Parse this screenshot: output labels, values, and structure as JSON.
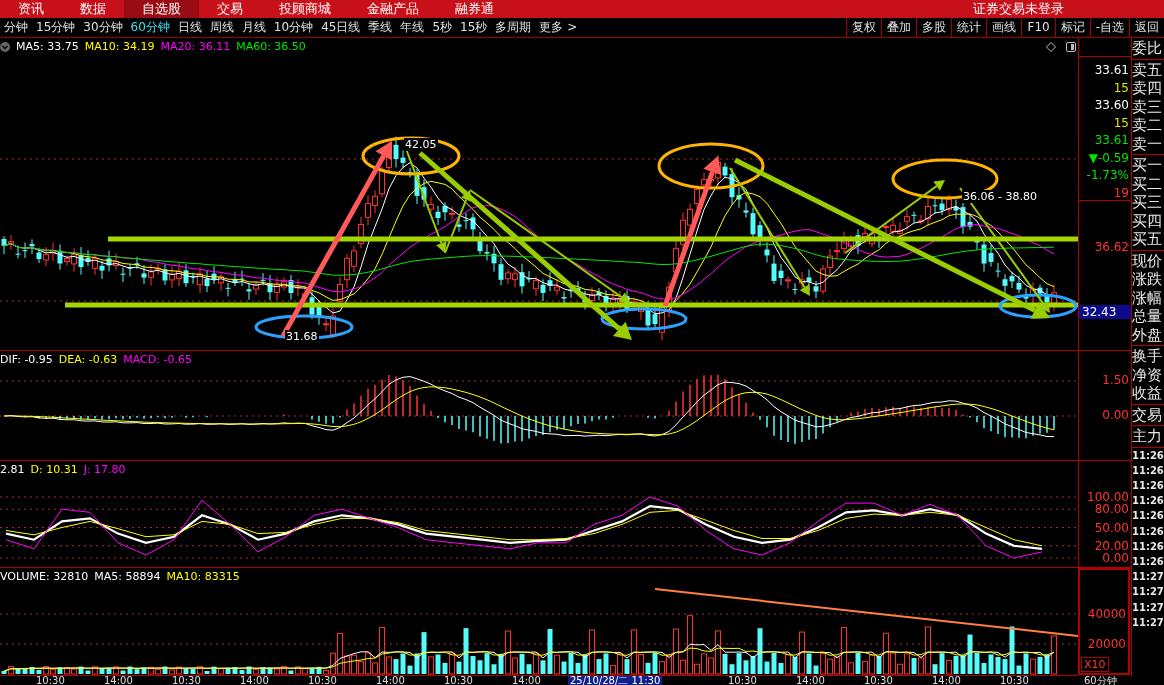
{
  "top_menu": [
    {
      "label": "资讯",
      "selected": false
    },
    {
      "label": "数据",
      "selected": false
    },
    {
      "label": "自选股",
      "selected": true
    },
    {
      "label": "交易",
      "selected": false
    },
    {
      "label": "投顾商城",
      "selected": false
    },
    {
      "label": "金融产品",
      "selected": false
    },
    {
      "label": "融券通",
      "selected": false
    }
  ],
  "top_status": "证券交易未登录",
  "periods": [
    {
      "label": "分钟",
      "selected": false
    },
    {
      "label": "15分钟",
      "selected": false
    },
    {
      "label": "30分钟",
      "selected": false
    },
    {
      "label": "60分钟",
      "selected": true
    },
    {
      "label": "日线",
      "selected": false
    },
    {
      "label": "周线",
      "selected": false
    },
    {
      "label": "月线",
      "selected": false
    },
    {
      "label": "10分钟",
      "selected": false
    },
    {
      "label": "45日线",
      "selected": false
    },
    {
      "label": "季线",
      "selected": false
    },
    {
      "label": "年线",
      "selected": false
    },
    {
      "label": "5秒",
      "selected": false
    },
    {
      "label": "15秒",
      "selected": false
    },
    {
      "label": "多周期",
      "selected": false
    }
  ],
  "more": "更多 >",
  "tools": [
    "复权",
    "叠加",
    "多股",
    "统计",
    "画线",
    "F10",
    "标记",
    "-自选",
    "返回"
  ],
  "main_chart": {
    "legend": [
      {
        "label": "MA5: 33.75",
        "color": "#ffffff"
      },
      {
        "label": "MA10: 34.19",
        "color": "#ffff00"
      },
      {
        "label": "MA20: 36.11",
        "color": "#ff00ff"
      },
      {
        "label": "MA60: 36.50",
        "color": "#00e600"
      }
    ],
    "high_label": "42.05",
    "low_label": "31.68",
    "range_label": "36.06 - 38.80"
  },
  "quote": [
    {
      "text": "33.61",
      "color": "#ffffff"
    },
    {
      "text": "15",
      "color": "#e6e600"
    },
    {
      "text": "33.60",
      "color": "#ffffff"
    },
    {
      "text": "15",
      "color": "#e6e600"
    },
    {
      "text": "33.61",
      "color": "#00e600"
    },
    {
      "text": "▼-0.59",
      "color": "#00e600"
    },
    {
      "text": "-1.73%",
      "color": "#00e600"
    },
    {
      "text": "19",
      "color": "#ff3232"
    }
  ],
  "price_marks": [
    {
      "text": "36.62",
      "kind": "line"
    },
    {
      "text": "32.43",
      "kind": "cursor"
    }
  ],
  "macd": {
    "legend": [
      {
        "label": "DIF: -0.95",
        "color": "#ffffff"
      },
      {
        "label": "DEA: -0.63",
        "color": "#ffff00"
      },
      {
        "label": "MACD: -0.65",
        "color": "#ff00ff"
      }
    ],
    "axis": [
      "1.50",
      "0.00"
    ]
  },
  "kdj": {
    "legend": [
      {
        "label": "2.81",
        "color": "#ffffff"
      },
      {
        "label": "D: 10.31",
        "color": "#ffff00"
      },
      {
        "label": "J: 17.80",
        "color": "#ff00ff"
      }
    ],
    "chart_data": {
      "type": "line",
      "ylim": [
        0,
        100
      ],
      "grid": true,
      "yticks": [
        {
          "value": 100,
          "label": "100.00"
        },
        {
          "value": 80,
          "label": "80.00"
        },
        {
          "value": 50,
          "label": "50.00"
        },
        {
          "value": 20,
          "label": "20.00"
        },
        {
          "value": 0,
          "label": "0.00"
        }
      ],
      "series": [
        {
          "color": "#ffffff",
          "values": [
            40,
            30,
            60,
            65,
            40,
            25,
            35,
            70,
            55,
            30,
            40,
            60,
            70,
            65,
            55,
            40,
            35,
            30,
            25,
            28,
            30,
            45,
            60,
            85,
            80,
            55,
            35,
            25,
            30,
            50,
            75,
            78,
            70,
            80,
            70,
            40,
            20,
            15
          ]
        },
        {
          "color": "#ffff00",
          "values": [
            45,
            38,
            50,
            60,
            48,
            35,
            38,
            60,
            55,
            40,
            42,
            55,
            65,
            65,
            58,
            45,
            40,
            35,
            30,
            30,
            32,
            40,
            55,
            75,
            78,
            62,
            45,
            32,
            32,
            45,
            65,
            72,
            70,
            75,
            70,
            50,
            30,
            20
          ]
        },
        {
          "color": "#ff00ff",
          "values": [
            30,
            15,
            80,
            75,
            25,
            5,
            30,
            95,
            55,
            10,
            35,
            70,
            80,
            65,
            50,
            30,
            25,
            20,
            15,
            25,
            25,
            55,
            70,
            100,
            85,
            45,
            15,
            5,
            25,
            60,
            90,
            90,
            70,
            88,
            70,
            20,
            0,
            10
          ]
        }
      ]
    }
  },
  "volume": {
    "legend": [
      {
        "label": "VOLUME: 32810",
        "color": "#ffffff"
      },
      {
        "label": "MA5: 58894",
        "color": "#ffffff"
      },
      {
        "label": "MA10: 83315",
        "color": "#ffff00"
      }
    ],
    "axis": [
      "40000",
      "20000"
    ],
    "scale": "X10"
  },
  "time_axis": [
    {
      "label": "10:30",
      "kind": "tick"
    },
    {
      "label": "14:00",
      "kind": "tick"
    },
    {
      "label": "10:30",
      "kind": "tick"
    },
    {
      "label": "14:00",
      "kind": "tick"
    },
    {
      "label": "10:30",
      "kind": "tick"
    },
    {
      "label": "14:00",
      "kind": "tick"
    },
    {
      "label": "10:30",
      "kind": "tick"
    },
    {
      "label": "14:00",
      "kind": "tick"
    },
    {
      "label": "25/10/28/二 11:30",
      "kind": "cursor"
    },
    {
      "label": "10:30",
      "kind": "tick"
    },
    {
      "label": "14:00",
      "kind": "tick"
    },
    {
      "label": "10:30",
      "kind": "tick"
    },
    {
      "label": "14:00",
      "kind": "tick"
    },
    {
      "label": "10:30",
      "kind": "tick"
    }
  ],
  "period_name": "60分钟",
  "side_groups": [
    [
      "委比"
    ],
    [
      "卖五",
      "卖四",
      "卖三",
      "卖二",
      "卖一"
    ],
    [
      "买一",
      "买二",
      "买三",
      "买四",
      "买五"
    ],
    [
      "现价",
      "涨跌",
      "涨幅",
      "总量",
      "外盘"
    ],
    [
      "换手",
      "净资",
      "收益"
    ],
    [
      "交易"
    ],
    [
      "主力"
    ]
  ],
  "times": [
    "11:26",
    "11:26",
    "11:26",
    "11:26",
    "11:26",
    "11:26",
    "11:26",
    "11:26",
    "11:27",
    "11:27",
    "11:27",
    "11:27"
  ]
}
